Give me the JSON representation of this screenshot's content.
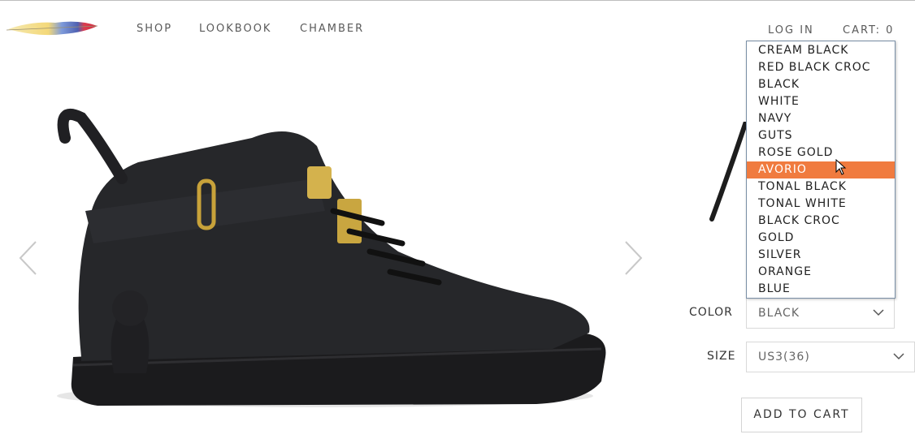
{
  "nav": {
    "items": [
      "SHOP",
      "LOOKBOOK",
      "CHAMBER"
    ]
  },
  "account": {
    "login": "LOG IN",
    "cart": "CART: 0"
  },
  "product": {
    "color_label": "COLOR",
    "color_value": "BLACK",
    "size_label": "SIZE",
    "size_value": "US3(36)",
    "add_to_cart": "ADD TO CART"
  },
  "color_dropdown": {
    "options": [
      "CREAM BLACK",
      "RED BLACK CROC",
      "BLACK",
      "WHITE",
      "NAVY",
      "GUTS",
      "ROSE GOLD",
      "AVORIO",
      "TONAL BLACK",
      "TONAL WHITE",
      "BLACK CROC",
      "GOLD",
      "SILVER",
      "ORANGE",
      "BLUE"
    ],
    "highlighted": "AVORIO",
    "highlight_color": "#f07b3f"
  },
  "icons": {
    "logo": "feather-logo",
    "prev": "chevron-left-icon",
    "next": "chevron-right-icon",
    "select_chevron": "chevron-down-icon",
    "cursor": "mouse-pointer-icon"
  }
}
